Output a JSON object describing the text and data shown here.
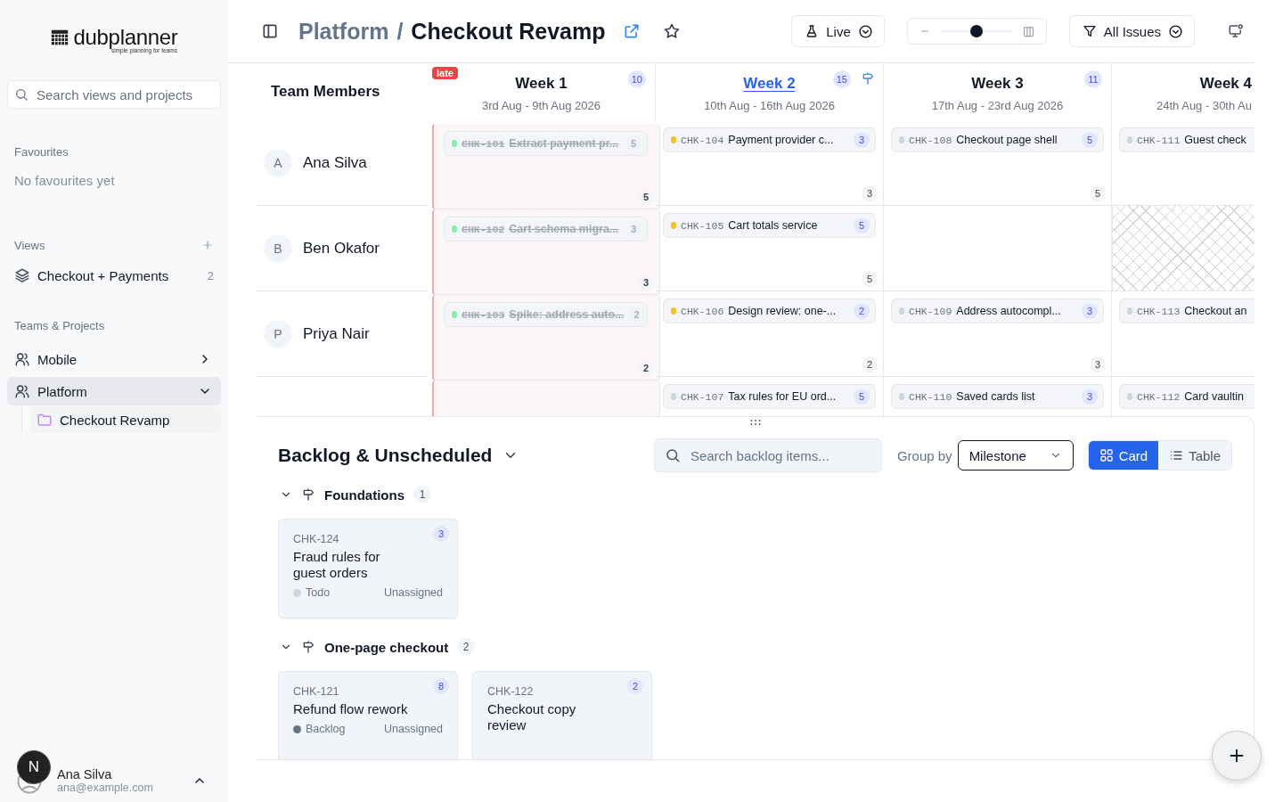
{
  "sidebar": {
    "logo": {
      "name": "dubplanner",
      "tagline": "simple planning for teams"
    },
    "search": {
      "placeholder": "Search views and projects"
    },
    "favourites": {
      "title": "Favourites",
      "empty": "No favourites yet"
    },
    "views": {
      "title": "Views",
      "items": [
        {
          "label": "Checkout + Payments",
          "count": "2"
        }
      ]
    },
    "teams": {
      "title": "Teams & Projects",
      "items": [
        {
          "label": "Mobile",
          "expanded": false,
          "selected": false
        },
        {
          "label": "Platform",
          "expanded": true,
          "selected": true,
          "children": [
            {
              "label": "Checkout Revamp",
              "selected": true
            }
          ]
        }
      ]
    },
    "user": {
      "initial": "N",
      "name": "Ana Silva",
      "email": "ana@example.com"
    }
  },
  "header": {
    "breadcrumb": "Platform",
    "separator": "/",
    "title": "Checkout Revamp",
    "mode": {
      "label": "Live"
    },
    "zoom": {
      "level": 0.5
    },
    "filter": {
      "label": "All Issues"
    }
  },
  "timeline": {
    "members_heading": "Team Members",
    "members": [
      {
        "initial": "A",
        "name": "Ana Silva"
      },
      {
        "initial": "B",
        "name": "Ben Okafor"
      },
      {
        "initial": "P",
        "name": "Priya Nair"
      }
    ],
    "weeks": [
      {
        "title": "Week 1",
        "dates": "3rd Aug - 9th Aug 2026",
        "count": "10",
        "late": true,
        "late_label": "late",
        "current": false,
        "milestone": false,
        "cells": [
          {
            "kind": "open",
            "total": "5",
            "cards": [
              {
                "id": "CHK-101",
                "title": "Extract payment pr...",
                "points": "5",
                "kind": "done"
              }
            ]
          },
          {
            "kind": "open",
            "total": "3",
            "cards": [
              {
                "id": "CHK-102",
                "title": "Cart schema migra...",
                "points": "3",
                "kind": "done"
              }
            ]
          },
          {
            "kind": "open",
            "total": "2",
            "cards": [
              {
                "id": "CHK-103",
                "title": "Spike: address auto...",
                "points": "2",
                "kind": "done"
              }
            ]
          },
          {
            "kind": "open"
          }
        ]
      },
      {
        "title": "Week 2",
        "dates": "10th Aug - 16th Aug 2026",
        "count": "15",
        "late": false,
        "current": true,
        "milestone": true,
        "cells": [
          {
            "kind": "open",
            "total": "3",
            "cards": [
              {
                "id": "CHK-104",
                "title": "Payment provider c...",
                "points": "3",
                "kind": "in_progress"
              }
            ]
          },
          {
            "kind": "open",
            "total": "5",
            "cards": [
              {
                "id": "CHK-105",
                "title": "Cart totals service",
                "points": "5",
                "kind": "in_progress"
              }
            ]
          },
          {
            "kind": "open",
            "total": "2",
            "cards": [
              {
                "id": "CHK-106",
                "title": "Design review: one-...",
                "points": "2",
                "kind": "in_progress"
              }
            ]
          },
          {
            "kind": "open",
            "cards": [
              {
                "id": "CHK-107",
                "title": "Tax rules for EU ord...",
                "points": "5",
                "kind": "todo"
              }
            ]
          }
        ]
      },
      {
        "title": "Week 3",
        "dates": "17th Aug - 23rd Aug 2026",
        "count": "11",
        "late": false,
        "current": false,
        "milestone": false,
        "cells": [
          {
            "kind": "open",
            "total": "5",
            "cards": [
              {
                "id": "CHK-108",
                "title": "Checkout page shell",
                "points": "5",
                "kind": "todo"
              }
            ]
          },
          {
            "kind": "open"
          },
          {
            "kind": "open",
            "total": "3",
            "cards": [
              {
                "id": "CHK-109",
                "title": "Address autocompl...",
                "points": "3",
                "kind": "todo"
              }
            ]
          },
          {
            "kind": "open",
            "cards": [
              {
                "id": "CHK-110",
                "title": "Saved cards list",
                "points": "3",
                "kind": "todo"
              }
            ]
          }
        ]
      },
      {
        "title": "Week 4",
        "dates": "24th Aug - 30th Au",
        "late": false,
        "current": false,
        "milestone": false,
        "cells": [
          {
            "kind": "open",
            "cards": [
              {
                "id": "CHK-111",
                "title": "Guest check",
                "kind": "todo"
              }
            ]
          },
          {
            "kind": "unavailable"
          },
          {
            "kind": "open",
            "cards": [
              {
                "id": "CHK-113",
                "title": "Checkout an",
                "kind": "todo"
              }
            ]
          },
          {
            "kind": "open",
            "cards": [
              {
                "id": "CHK-112",
                "title": "Card vaultin",
                "kind": "todo"
              }
            ]
          }
        ]
      }
    ]
  },
  "backlog": {
    "title": "Backlog & Unscheduled",
    "search": {
      "placeholder": "Search backlog items..."
    },
    "group_by": {
      "label": "Group by",
      "value": "Milestone"
    },
    "views": [
      {
        "label": "Card",
        "kind": "card",
        "selected": true
      },
      {
        "label": "Table",
        "kind": "table",
        "selected": false
      }
    ],
    "groups": [
      {
        "name": "Foundations",
        "count": "1",
        "expanded": true,
        "items": [
          {
            "id": "CHK-124",
            "title": "Fraud rules for guest orders",
            "points": "3",
            "status": "Todo",
            "kind": "todo",
            "assignee": "Unassigned"
          }
        ]
      },
      {
        "name": "One-page checkout",
        "count": "2",
        "expanded": true,
        "items": [
          {
            "id": "CHK-121",
            "title": "Refund flow rework",
            "points": "8",
            "status": "Backlog",
            "kind": "backlog",
            "assignee": "Unassigned"
          },
          {
            "id": "CHK-122",
            "title": "Checkout copy review",
            "points": "2"
          }
        ]
      }
    ]
  }
}
